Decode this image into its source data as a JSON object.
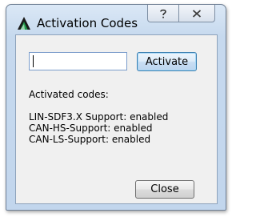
{
  "window": {
    "title": "Activation Codes",
    "help_glyph": "?",
    "close_glyph": "✕",
    "app_icon": "triangle-logo-icon"
  },
  "form": {
    "code_value": "",
    "activate_label": "Activate"
  },
  "codes": {
    "heading": "Activated codes:",
    "items": [
      {
        "text": "LIN-SDF3.X Support: enabled"
      },
      {
        "text": "CAN-HS-Support: enabled"
      },
      {
        "text": "CAN-LS-Support: enabled"
      }
    ]
  },
  "footer": {
    "close_label": "Close"
  },
  "colors": {
    "accent": "#1f9a4a",
    "logo_dark": "#1a1a1a"
  }
}
